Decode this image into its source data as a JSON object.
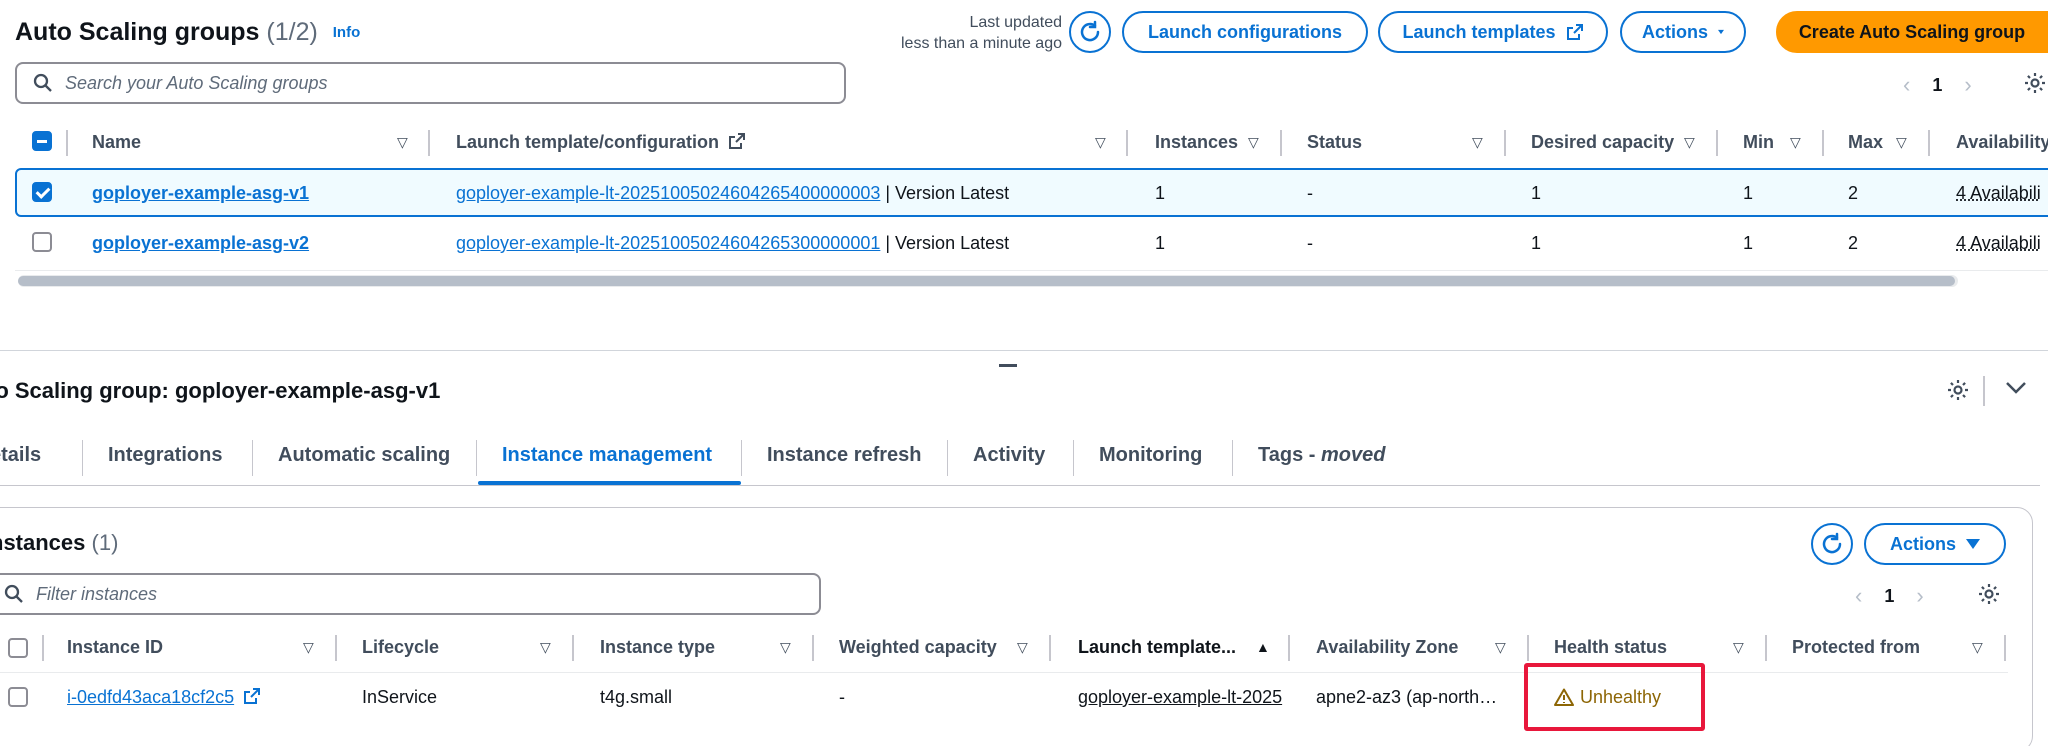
{
  "header": {
    "title": "Auto Scaling groups",
    "count": "(1/2)",
    "info": "Info",
    "last_updated_line1": "Last updated",
    "last_updated_line2": "less than a minute ago",
    "buttons": {
      "launch_configurations": "Launch configurations",
      "launch_templates": "Launch templates",
      "actions": "Actions",
      "create": "Create Auto Scaling group"
    },
    "search_placeholder": "Search your Auto Scaling groups",
    "page": "1"
  },
  "asg_table": {
    "columns": [
      "Name",
      "Launch template/configuration",
      "Instances",
      "Status",
      "Desired capacity",
      "Min",
      "Max",
      "Availability"
    ],
    "rows": [
      {
        "selected": true,
        "name": "goployer-example-asg-v1",
        "template_link": "goployer-example-lt-20251005024604265400000003",
        "template_version": " | Version Latest",
        "instances": "1",
        "status": "-",
        "desired": "1",
        "min": "1",
        "max": "2",
        "availability": "4 Availabili"
      },
      {
        "selected": false,
        "name": "goployer-example-asg-v2",
        "template_link": "goployer-example-lt-20251005024604265300000001",
        "template_version": " | Version Latest",
        "instances": "1",
        "status": "-",
        "desired": "1",
        "min": "1",
        "max": "2",
        "availability": "4 Availabili"
      }
    ]
  },
  "details": {
    "title": "to Scaling group: goployer-example-asg-v1",
    "tabs": [
      "etails",
      "Integrations",
      "Automatic scaling",
      "Instance management",
      "Instance refresh",
      "Activity",
      "Monitoring",
      "Tags - "
    ],
    "tags_suffix": "moved",
    "active_tab": "Instance management"
  },
  "instances": {
    "title": "nstances",
    "count": "(1)",
    "actions": "Actions",
    "filter_placeholder": "Filter instances",
    "page": "1",
    "columns": [
      "Instance ID",
      "Lifecycle",
      "Instance type",
      "Weighted capacity",
      "Launch template...",
      "Availability Zone",
      "Health status",
      "Protected from"
    ],
    "rows": [
      {
        "instance_id": "i-0edfd43aca18cf2c5",
        "lifecycle": "InService",
        "instance_type": "t4g.small",
        "weighted_capacity": "-",
        "launch_template": "goployer-example-lt-2025",
        "availability_zone": "apne2-az3 (ap-north…",
        "health_status": "Unhealthy",
        "protected_from": ""
      }
    ]
  },
  "colors": {
    "link": "#0972d3",
    "primary_button": "#ff9900",
    "warning": "#8d6605",
    "highlight": "#e8173b"
  }
}
